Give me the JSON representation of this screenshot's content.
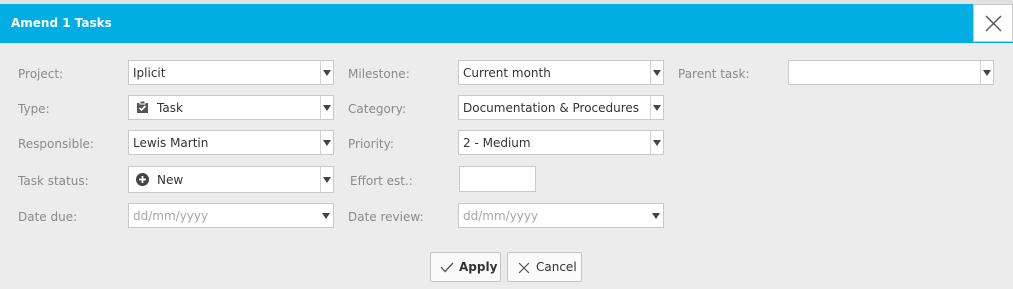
{
  "dialog": {
    "title": "Amend 1 Tasks"
  },
  "fields": {
    "project": {
      "label": "Project:",
      "value": "Iplicit"
    },
    "milestone": {
      "label": "Milestone:",
      "value": "Current month"
    },
    "parent_task": {
      "label": "Parent task:",
      "value": ""
    },
    "type": {
      "label": "Type:",
      "value": "Task",
      "icon": "task-check-icon"
    },
    "category": {
      "label": "Category:",
      "value": "Documentation & Procedures"
    },
    "responsible": {
      "label": "Responsible:",
      "value": "Lewis Martin"
    },
    "priority": {
      "label": "Priority:",
      "value": "2 - Medium"
    },
    "task_status": {
      "label": "Task status:",
      "value": "New",
      "icon": "plus-circle-icon"
    },
    "effort": {
      "label": "Effort est.:",
      "value": ""
    },
    "date_due": {
      "label": "Date due:",
      "placeholder": "dd/mm/yyyy"
    },
    "date_review": {
      "label": "Date review:",
      "placeholder": "dd/mm/yyyy"
    }
  },
  "buttons": {
    "apply": "Apply",
    "cancel": "Cancel"
  },
  "colors": {
    "titlebar": "#00aee3",
    "background": "#ececec"
  }
}
